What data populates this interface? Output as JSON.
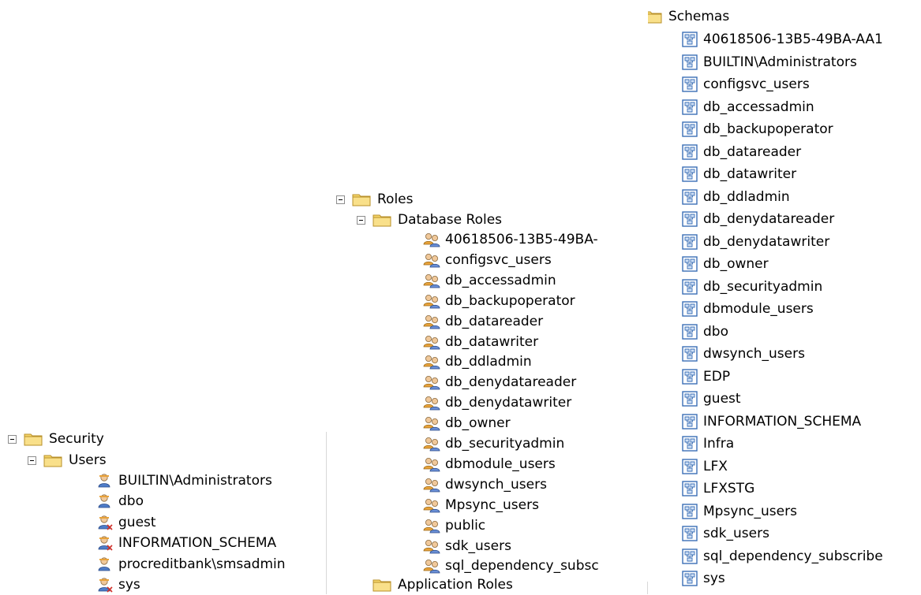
{
  "security_pane": {
    "security": "Security",
    "users": "Users",
    "user_items": [
      "BUILTIN\\Administrators",
      "dbo",
      "guest",
      "INFORMATION_SCHEMA",
      "procreditbank\\smsadmin",
      "sys"
    ]
  },
  "roles_pane": {
    "roles": "Roles",
    "database_roles": "Database Roles",
    "role_items": [
      "40618506-13B5-49BA-",
      "configsvc_users",
      "db_accessadmin",
      "db_backupoperator",
      "db_datareader",
      "db_datawriter",
      "db_ddladmin",
      "db_denydatareader",
      "db_denydatawriter",
      "db_owner",
      "db_securityadmin",
      "dbmodule_users",
      "dwsynch_users",
      "Mpsync_users",
      "public",
      "sdk_users",
      "sql_dependency_subsc"
    ],
    "application_roles": "Application Roles"
  },
  "schemas_pane": {
    "schemas": "Schemas",
    "schema_items": [
      "40618506-13B5-49BA-AA1",
      "BUILTIN\\Administrators",
      "configsvc_users",
      "db_accessadmin",
      "db_backupoperator",
      "db_datareader",
      "db_datawriter",
      "db_ddladmin",
      "db_denydatareader",
      "db_denydatawriter",
      "db_owner",
      "db_securityadmin",
      "dbmodule_users",
      "dbo",
      "dwsynch_users",
      "EDP",
      "guest",
      "INFORMATION_SCHEMA",
      "Infra",
      "LFX",
      "LFXSTG",
      "Mpsync_users",
      "sdk_users",
      "sql_dependency_subscribe",
      "sys"
    ]
  },
  "colors": {
    "folder_fill": "#f6d66a",
    "folder_edge": "#b8902a",
    "schema_icon": "#3b6fb6",
    "user_icon": "#e8a23a",
    "role_icon": "#6a8fd6"
  },
  "icons": {
    "expanded_toggle": "minus-box-icon",
    "folder": "folder-icon",
    "user": "user-icon",
    "role": "role-icon",
    "schema": "schema-icon"
  }
}
